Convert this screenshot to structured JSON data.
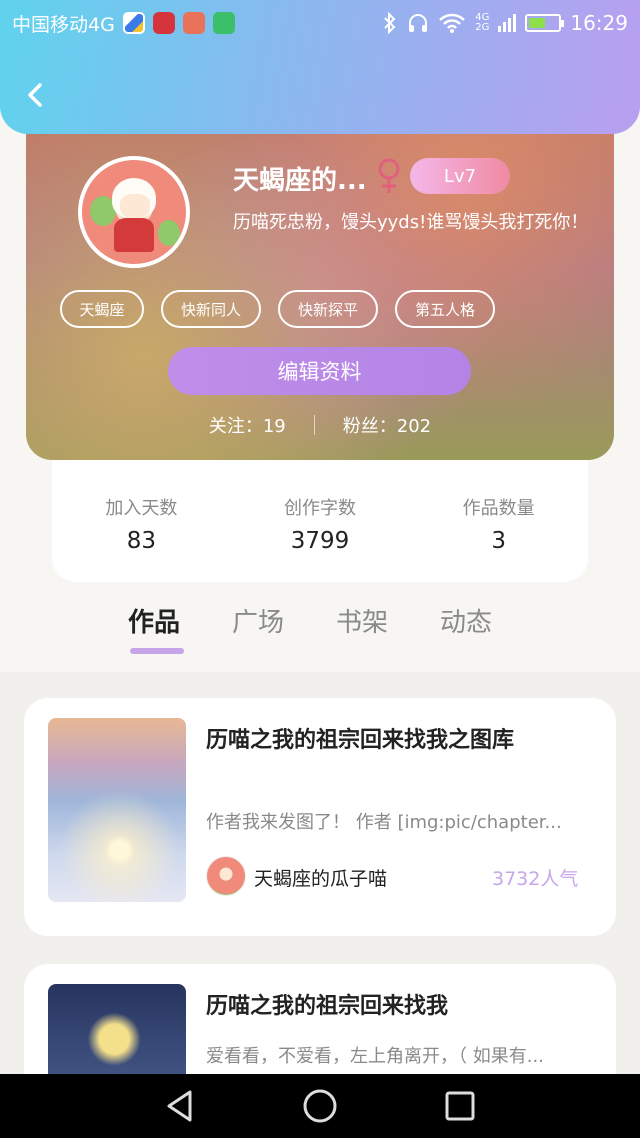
{
  "status_bar": {
    "carrier": "中国移动4G",
    "net_top": "4G",
    "net_bottom": "2G",
    "time": "16:29"
  },
  "header": {
    "back_icon": "chevron-left-icon"
  },
  "profile": {
    "username": "天蝎座的...",
    "gender_icon": "female-icon",
    "level": "Lv7",
    "bio": "历喵死忠粉，馒头yyds!谁骂馒头我打死你！",
    "tags": [
      "天蝎座",
      "快新同人",
      "快新探平",
      "第五人格"
    ],
    "edit_label": "编辑资料",
    "following": "关注：19",
    "followers": "粉丝：202"
  },
  "stats": [
    {
      "label": "加入天数",
      "value": "83"
    },
    {
      "label": "创作字数",
      "value": "3799"
    },
    {
      "label": "作品数量",
      "value": "3"
    }
  ],
  "tabs": [
    {
      "label": "作品",
      "active": true
    },
    {
      "label": "广场",
      "active": false
    },
    {
      "label": "书架",
      "active": false
    },
    {
      "label": "动态",
      "active": false
    }
  ],
  "works": [
    {
      "title": "历喵之我的祖宗回来找我之图库",
      "excerpt": "作者我来发图了！  作者 [img:pic/chapter...",
      "author": "天蝎座的瓜子喵",
      "popularity": "3732人气"
    },
    {
      "title": "历喵之我的祖宗回来找我",
      "excerpt": "爱看看，不爱看，左上角离开，（ 如果有...",
      "author": "",
      "popularity": ""
    }
  ],
  "colors": {
    "header_start": "#5fd3ee",
    "header_end": "#b99ff0",
    "accent_purple": "#b384e6",
    "popularity": "#c8a6ea"
  }
}
